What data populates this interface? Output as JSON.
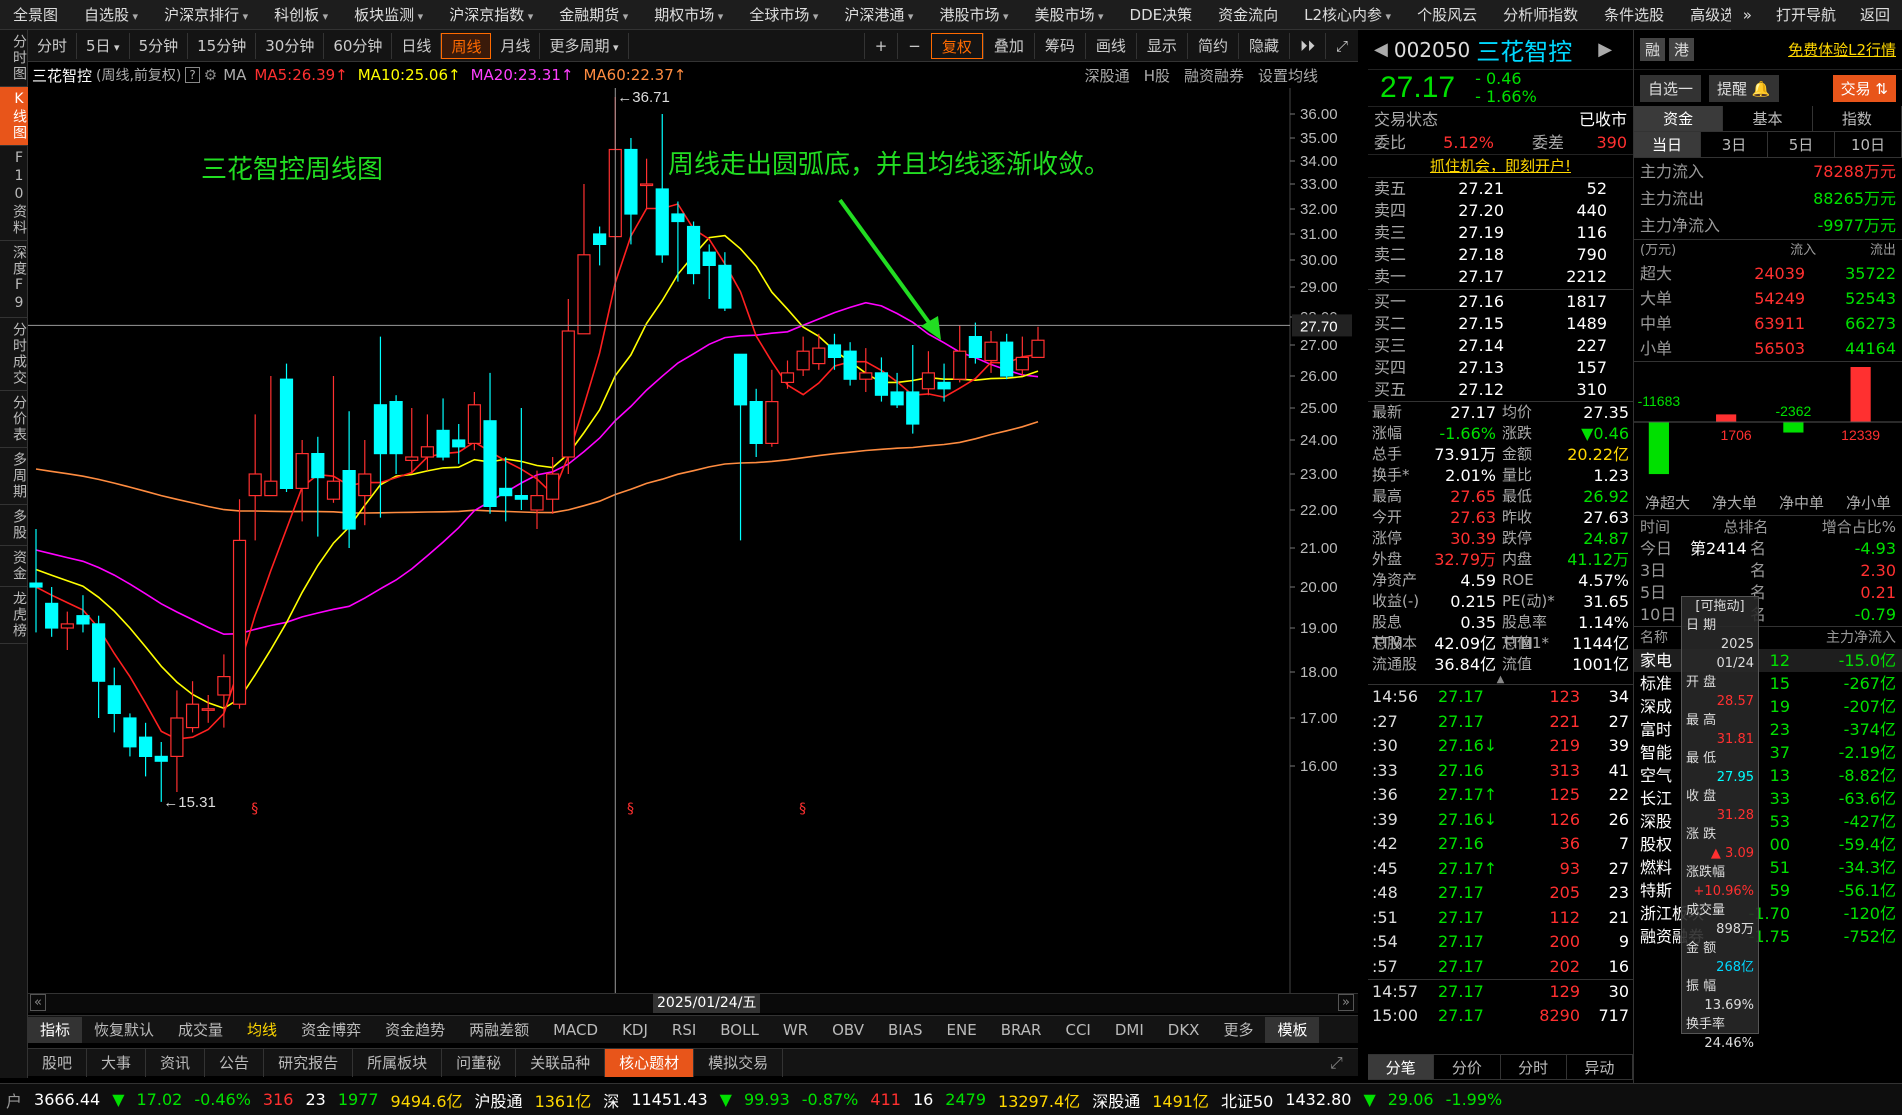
{
  "topmenu": {
    "items": [
      "全景图",
      "自选股",
      "沪深京排行",
      "科创板",
      "板块监测",
      "沪深京指数",
      "金融期货",
      "期权市场",
      "全球市场",
      "沪深港通",
      "港股市场",
      "美股市场",
      "DDE决策",
      "资金流向",
      "L2核心内参",
      "个股风云",
      "分析师指数",
      "条件选股",
      "高级选股"
    ],
    "right": [
      "»",
      "打开导航",
      "返回"
    ]
  },
  "leftbar": [
    "分时图",
    "K线图",
    "F10资料",
    "深度F9",
    "分时成交",
    "分价表",
    "多周期",
    "多股",
    "资金",
    "龙虎榜"
  ],
  "periodbar": {
    "items": [
      "分时",
      "5日",
      "5分钟",
      "15分钟",
      "30分钟",
      "60分钟",
      "日线",
      "周线",
      "月线",
      "更多周期"
    ],
    "active": "周线",
    "right": [
      "+",
      "−",
      "复权",
      "叠加",
      "筹码",
      "画线",
      "显示",
      "简约",
      "隐藏"
    ]
  },
  "ma_row": {
    "name": "三花智控",
    "desc": "(周线,前复权)",
    "ma_label": "MA",
    "ma5": "MA5:26.39↑",
    "ma10": "MA10:25.06↑",
    "ma20": "MA20:23.31↑",
    "ma60": "MA60:22.37↑",
    "links": [
      "深股通",
      "H股",
      "融资融券",
      "设置均线"
    ]
  },
  "chart_data": {
    "type": "candlestick",
    "ylim": [
      15.0,
      37.0
    ],
    "yticks": [
      "36.00",
      "35.00",
      "34.00",
      "33.00",
      "32.00",
      "31.00",
      "30.00",
      "29.00",
      "28.00",
      "27.00",
      "26.00",
      "25.00",
      "24.00",
      "23.00",
      "22.00",
      "21.00",
      "20.00",
      "19.00",
      "18.00",
      "17.00",
      "16.00"
    ],
    "crosshair_price": "27.70",
    "high_label": "36.71",
    "low_label": "15.31",
    "date_label": "2025/01/24/五",
    "annotation_title": "三花智控周线图",
    "annotation_note": "周线走出圆弧底，并且均线逐渐收敛。",
    "candles": [
      [
        20.1,
        20.0,
        21.5,
        18.9
      ],
      [
        19.6,
        19.0,
        20.0,
        18.8
      ],
      [
        19.0,
        19.1,
        19.4,
        18.5
      ],
      [
        19.3,
        19.1,
        19.8,
        18.9
      ],
      [
        19.1,
        17.8,
        19.3,
        17.0
      ],
      [
        17.7,
        17.1,
        18.1,
        16.7
      ],
      [
        17.0,
        16.4,
        17.1,
        16.2
      ],
      [
        16.6,
        16.2,
        16.9,
        15.8
      ],
      [
        16.2,
        16.1,
        16.5,
        15.31
      ],
      [
        16.2,
        17.0,
        17.6,
        15.5
      ],
      [
        16.8,
        17.3,
        17.8,
        16.7
      ],
      [
        17.2,
        17.2,
        17.5,
        16.9
      ],
      [
        17.5,
        17.9,
        18.4,
        16.8
      ],
      [
        17.3,
        21.2,
        22.3,
        17.2
      ],
      [
        22.4,
        23.0,
        24.8,
        21.2
      ],
      [
        22.4,
        22.8,
        26.0,
        22.6
      ],
      [
        25.9,
        22.6,
        26.4,
        22.5
      ],
      [
        22.6,
        23.6,
        24.0,
        21.7
      ],
      [
        23.6,
        22.9,
        24.1,
        21.3
      ],
      [
        22.3,
        22.8,
        26.0,
        22.2
      ],
      [
        23.1,
        21.5,
        24.9,
        21.0
      ],
      [
        22.4,
        23.0,
        24.0,
        21.6
      ],
      [
        25.1,
        23.6,
        27.3,
        21.8
      ],
      [
        25.2,
        23.6,
        25.4,
        23.0
      ],
      [
        23.4,
        23.5,
        25.0,
        23.0
      ],
      [
        23.5,
        23.8,
        24.8,
        23.1
      ],
      [
        24.3,
        23.5,
        25.3,
        23.4
      ],
      [
        24.0,
        23.8,
        24.5,
        23.3
      ],
      [
        23.9,
        25.1,
        25.5,
        23.7
      ],
      [
        24.6,
        22.1,
        26.1,
        21.9
      ],
      [
        22.6,
        22.4,
        23.5,
        21.7
      ],
      [
        22.4,
        22.3,
        25.0,
        22.0
      ],
      [
        22.0,
        22.4,
        23.1,
        21.5
      ],
      [
        22.3,
        23.0,
        23.5,
        21.9
      ],
      [
        23.5,
        27.5,
        28.6,
        23.0
      ],
      [
        27.4,
        30.2,
        33.0,
        29.0
      ],
      [
        31.0,
        30.6,
        31.3,
        29.8
      ],
      [
        30.9,
        34.5,
        36.71,
        29.0
      ],
      [
        34.5,
        31.8,
        35.0,
        30.6
      ],
      [
        33.0,
        33.0,
        34.1,
        32.0
      ],
      [
        32.8,
        30.2,
        36.0,
        29.9
      ],
      [
        31.8,
        31.5,
        32.3,
        29.2
      ],
      [
        31.3,
        29.5,
        31.5,
        29.1
      ],
      [
        30.3,
        29.8,
        30.6,
        28.6
      ],
      [
        29.8,
        28.3,
        30.3,
        28.2
      ],
      [
        26.7,
        25.1,
        25.3,
        21.2
      ],
      [
        25.2,
        23.9,
        25.6,
        23.5
      ],
      [
        23.9,
        25.2,
        26.2,
        23.8
      ],
      [
        25.8,
        26.1,
        26.5,
        25.6
      ],
      [
        26.2,
        26.8,
        27.3,
        26.0
      ],
      [
        26.4,
        26.9,
        27.4,
        26.2
      ],
      [
        27.0,
        26.6,
        27.4,
        26.2
      ],
      [
        26.8,
        25.9,
        27.1,
        25.7
      ],
      [
        25.9,
        26.1,
        26.9,
        25.5
      ],
      [
        26.1,
        25.4,
        26.6,
        25.2
      ],
      [
        25.5,
        25.1,
        26.1,
        25.0
      ],
      [
        25.5,
        24.5,
        27.0,
        24.2
      ],
      [
        25.6,
        26.1,
        26.8,
        25.4
      ],
      [
        25.8,
        25.6,
        26.4,
        25.2
      ],
      [
        25.9,
        26.8,
        27.7,
        25.8
      ],
      [
        27.3,
        26.6,
        27.8,
        26.4
      ],
      [
        26.5,
        27.1,
        27.5,
        26.1
      ],
      [
        27.1,
        26.0,
        27.4,
        25.9
      ],
      [
        26.2,
        26.6,
        27.3,
        26.0
      ],
      [
        26.6,
        27.17,
        27.65,
        26.92
      ]
    ]
  },
  "bottomtabs1": [
    "指标",
    "恢复默认",
    "成交量",
    "均线",
    "资金博弈",
    "资金趋势",
    "两融差额",
    "MACD",
    "KDJ",
    "RSI",
    "BOLL",
    "WR",
    "OBV",
    "BIAS",
    "ENE",
    "BRAR",
    "CCI",
    "DMI",
    "DKX",
    "更多",
    "模板"
  ],
  "bottomtabs2": [
    "股吧",
    "大事",
    "资讯",
    "公告",
    "研究报告",
    "所属板块",
    "问董秘",
    "关联品种",
    "核心题材",
    "模拟交易"
  ],
  "quote": {
    "code": "002050",
    "name": "三花智控",
    "badges": [
      "融",
      "港"
    ],
    "promo": "免费体验L2行情",
    "price": "27.17",
    "change": "- 0.46",
    "pct": "- 1.66%",
    "btn_zixuan": "自选一",
    "btn_tixing": "提醒",
    "btn_trade": "交易",
    "status_label": "交易状态",
    "status_val": "已收市",
    "weibi_l": "委比",
    "weibi": "5.12%",
    "weicha_l": "委差",
    "weicha": "390",
    "ad": "抓住机会，即刻开户!",
    "asks": [
      [
        "卖五",
        "27.21",
        "52"
      ],
      [
        "卖四",
        "27.20",
        "440"
      ],
      [
        "卖三",
        "27.19",
        "116"
      ],
      [
        "卖二",
        "27.18",
        "790"
      ],
      [
        "卖一",
        "27.17",
        "2212"
      ]
    ],
    "bids": [
      [
        "买一",
        "27.16",
        "1817"
      ],
      [
        "买二",
        "27.15",
        "1489"
      ],
      [
        "买三",
        "27.14",
        "227"
      ],
      [
        "买四",
        "27.13",
        "157"
      ],
      [
        "买五",
        "27.12",
        "310"
      ]
    ],
    "stats": [
      [
        "最新",
        "27.17",
        "均价",
        "27.35"
      ],
      [
        "涨幅",
        "-1.66%",
        "涨跌",
        "▼0.46"
      ],
      [
        "总手",
        "73.91万",
        "金额",
        "20.22亿"
      ],
      [
        "换手*",
        "2.01%",
        "量比",
        "1.23"
      ],
      [
        "最高",
        "27.65",
        "最低",
        "26.92"
      ],
      [
        "今开",
        "27.63",
        "昨收",
        "27.63"
      ],
      [
        "涨停",
        "30.39",
        "跌停",
        "24.87"
      ],
      [
        "外盘",
        "32.79万",
        "内盘",
        "41.12万"
      ],
      [
        "净资产",
        "4.59",
        "ROE",
        "4.57%"
      ],
      [
        "收益(-)",
        "0.215",
        "PE(动)*",
        "31.65"
      ],
      [
        "股息TTM",
        "0.35",
        "股息率TTM",
        "1.14%"
      ],
      [
        "总股本",
        "42.09亿",
        "总值1*",
        "1144亿"
      ],
      [
        "流通股",
        "36.84亿",
        "流值",
        "1001亿"
      ]
    ],
    "ticks": [
      [
        "14:56",
        "27.17",
        "123",
        "34"
      ],
      [
        ":27",
        "27.17",
        "221",
        "27"
      ],
      [
        ":30",
        "27.16↓",
        "219",
        "39"
      ],
      [
        ":33",
        "27.16",
        "313",
        "41"
      ],
      [
        ":36",
        "27.17↑",
        "125",
        "22"
      ],
      [
        ":39",
        "27.16↓",
        "126",
        "26"
      ],
      [
        ":42",
        "27.16",
        "36",
        "7"
      ],
      [
        ":45",
        "27.17↑",
        "93",
        "27"
      ],
      [
        ":48",
        "27.17",
        "205",
        "23"
      ],
      [
        ":51",
        "27.17",
        "112",
        "21"
      ],
      [
        ":54",
        "27.17",
        "200",
        "9"
      ],
      [
        ":57",
        "27.17",
        "202",
        "16"
      ],
      [
        "14:57",
        "27.17",
        "129",
        "30"
      ],
      [
        "15:00",
        "27.17",
        "8290",
        "717"
      ]
    ],
    "tick_tabs": [
      "分笔",
      "分价",
      "分时",
      "异动"
    ]
  },
  "fund": {
    "tabs": [
      "资金",
      "基本",
      "指数"
    ],
    "subtabs": [
      "当日",
      "3日",
      "5日",
      "10日"
    ],
    "inflow_l": "主力流入",
    "inflow": "78288万元",
    "outflow_l": "主力流出",
    "outflow": "88265万元",
    "net_l": "主力净流入",
    "net": "-9977万元",
    "unit": "(万元)",
    "in_h": "流入",
    "out_h": "流出",
    "rows": [
      [
        "超大",
        "24039",
        "35722"
      ],
      [
        "大单",
        "54249",
        "52543"
      ],
      [
        "中单",
        "63911",
        "66273"
      ],
      [
        "小单",
        "56503",
        "44164"
      ]
    ],
    "bars": [
      "-11683",
      "1706",
      "-2362",
      "12339"
    ],
    "bar_labels": [
      "净超大",
      "净大单",
      "净中单",
      "净小单"
    ],
    "rank_h": [
      "时间",
      "总排名",
      "增合占比%"
    ],
    "ranks": [
      [
        "今日",
        "第2414",
        "名",
        "-4.93"
      ],
      [
        "3日",
        "",
        "名",
        "2.30"
      ],
      [
        "5日",
        "",
        "名",
        "0.21"
      ],
      [
        "10日",
        "",
        "名",
        "-0.79"
      ]
    ],
    "sect_h": [
      "名称",
      "",
      "主力净流入"
    ],
    "sectors": [
      [
        "家电",
        "12",
        "-15.0亿"
      ],
      [
        "标准",
        "15",
        "-267亿"
      ],
      [
        "深成",
        "19",
        "-207亿"
      ],
      [
        "富时",
        "23",
        "-374亿"
      ],
      [
        "智能",
        "37",
        "-2.19亿"
      ],
      [
        "空气",
        "13",
        "-8.82亿"
      ],
      [
        "长江",
        "33",
        "-63.6亿"
      ],
      [
        "深股",
        "53",
        "-427亿"
      ],
      [
        "股权",
        "00",
        "-59.4亿"
      ],
      [
        "燃料",
        "51",
        "-34.3亿"
      ],
      [
        "特斯",
        "59",
        "-56.1亿"
      ],
      [
        "浙江板块",
        "-1.70",
        "-120亿"
      ],
      [
        "融资融券",
        "-1.75",
        "-752亿"
      ]
    ]
  },
  "popup": {
    "title": "[可拖动]",
    "rows": [
      [
        "日 期",
        ""
      ],
      [
        "",
        "2025"
      ],
      [
        "",
        "01/24"
      ],
      [
        "开 盘",
        ""
      ],
      [
        "",
        "28.57"
      ],
      [
        "最 高",
        ""
      ],
      [
        "",
        "31.81"
      ],
      [
        "最 低",
        ""
      ],
      [
        "",
        "27.95"
      ],
      [
        "收 盘",
        ""
      ],
      [
        "",
        "31.28"
      ],
      [
        "涨 跌",
        ""
      ],
      [
        "",
        "▲ 3.09"
      ],
      [
        "涨跌幅",
        ""
      ],
      [
        "",
        "+10.96%"
      ],
      [
        "成交量",
        ""
      ],
      [
        "",
        "898万"
      ],
      [
        "金 额",
        ""
      ],
      [
        "",
        "268亿"
      ],
      [
        "振 幅",
        ""
      ],
      [
        "",
        "13.69%"
      ],
      [
        "换手率",
        ""
      ],
      [
        "",
        "24.46%"
      ]
    ]
  },
  "statusbar": [
    "户",
    "3666.44",
    "▼",
    "17.02",
    "-0.46%",
    "316",
    "23",
    "1977",
    "9494.6亿",
    "沪股通",
    "1361亿",
    "深",
    "11451.43",
    "▼",
    "99.93",
    "-0.87%",
    "411",
    "16",
    "2479",
    "13297.4亿",
    "深股通",
    "1491亿",
    "北证50",
    "1432.80",
    "▼",
    "29.06",
    "-1.99%"
  ],
  "colors": {
    "up": "#ff3030",
    "down": "#00ffff",
    "ma5": "#ff2020",
    "ma10": "#ffff00",
    "ma20": "#ff00ff",
    "ma60": "#ff8c40",
    "accent": "#e8551a"
  }
}
